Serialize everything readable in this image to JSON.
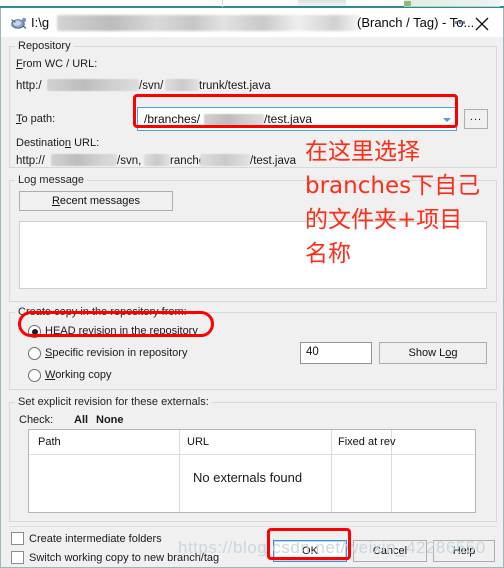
{
  "window": {
    "title_prefix": "I:\\g",
    "title_suffix": "(Branch / Tag) - To...",
    "icon": "tortoisesvn-icon",
    "close_label": "✕"
  },
  "repository": {
    "group_label": "Repository",
    "from_label": "From WC / URL:",
    "from_value_prefix": "http:/",
    "from_value_mid": "/svn/",
    "from_value_suffix": "trunk/test.java",
    "to_path_label": "To path:",
    "to_path_value": "/branches/",
    "to_path_value_tail": "/test.java",
    "browse_label": "...",
    "dest_label": "Destination URL:",
    "dest_prefix": "http://",
    "dest_mid1": "/svn,",
    "dest_mid2": "ranche:",
    "dest_suffix": "/test.java"
  },
  "log_message": {
    "group_label": "Log message",
    "recent_button": "Recent messages",
    "text": ""
  },
  "create_copy": {
    "group_label": "Create copy in the repository from:",
    "options": [
      {
        "label": "HEAD revision in the repository",
        "selected": true
      },
      {
        "label": "Specific revision in repository",
        "selected": false
      },
      {
        "label": "Working copy",
        "selected": false
      }
    ],
    "revision_value": "40",
    "show_log_button": "Show Log"
  },
  "externals": {
    "group_label": "Set explicit revision for these externals:",
    "check_label": "Check:",
    "check_all": "All",
    "check_none": "None",
    "columns": [
      "Path",
      "URL",
      "Fixed at rev",
      ""
    ],
    "empty_message": "No externals found",
    "rows": []
  },
  "footer": {
    "checkboxes": [
      {
        "label": "Create intermediate folders",
        "checked": false
      },
      {
        "label": "Switch working copy to new branch/tag",
        "checked": false
      }
    ],
    "ok_button": "OK",
    "cancel_button": "Cancel",
    "help_button": "Help"
  },
  "annotations": {
    "text_1": "在这里选择",
    "text_2": "branches下自己",
    "text_3": "的文件夹+项目",
    "text_4": "名称",
    "color": "#ff2d18"
  },
  "watermark": {
    "text": "https://blog.csdn.net/weixin_42286550"
  }
}
